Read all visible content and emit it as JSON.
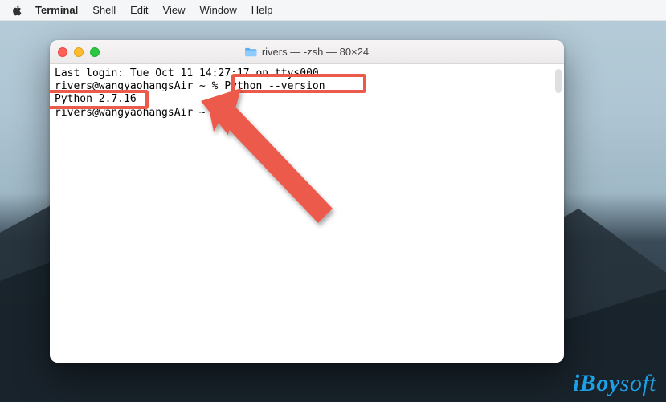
{
  "menubar": {
    "app": "Terminal",
    "items": [
      "Shell",
      "Edit",
      "View",
      "Window",
      "Help"
    ]
  },
  "window": {
    "title_icon": "folder",
    "title": "rivers — -zsh — 80×24"
  },
  "terminal": {
    "line1": "Last login: Tue Oct 11 14:27:17 on ttys000",
    "prompt1_user": "rivers@wangyaohangsAir",
    "prompt1_tail": " ~ % ",
    "command1": "Python --version",
    "output1": "Python 2.7.16",
    "prompt2_user": "rivers@wangyaohangsAir",
    "prompt2_tail": " ~ % "
  },
  "annotations": {
    "highlight_command": "Python --version",
    "highlight_output": "Python 2.7.16",
    "arrow_target": "prompt-cursor"
  },
  "watermark": {
    "brand": "iBoy",
    "suffix": "soft"
  },
  "colors": {
    "highlight": "#eb5a4b",
    "traffic_red": "#ff5f57",
    "traffic_yellow": "#febc2e",
    "traffic_green": "#28c840",
    "watermark": "#1ea0e6"
  }
}
